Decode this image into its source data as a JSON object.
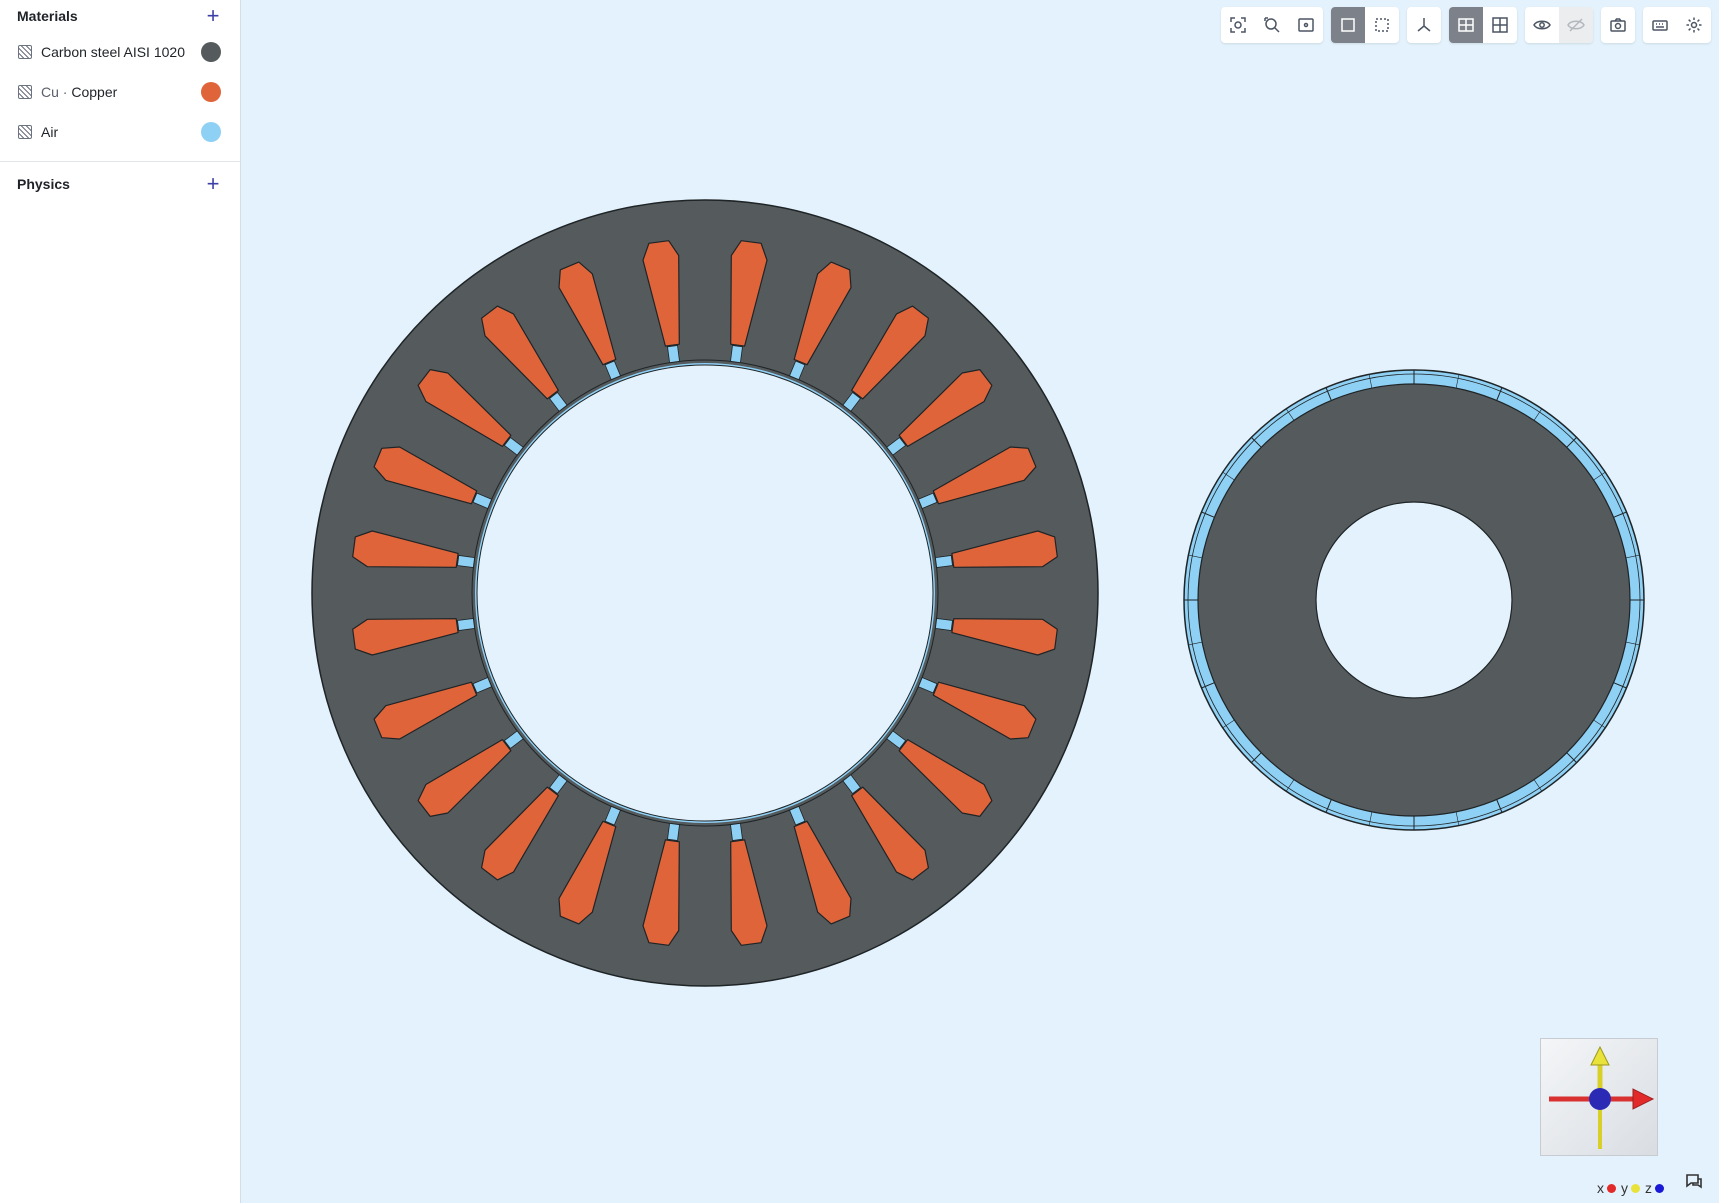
{
  "sidebar": {
    "materials_title": "Materials",
    "physics_title": "Physics",
    "materials": [
      {
        "prefix": "",
        "name": "Carbon steel AISI 1020",
        "color": "#555b5d"
      },
      {
        "prefix": "Cu · ",
        "name": "Copper",
        "color": "#e0643a"
      },
      {
        "prefix": "",
        "name": "Air",
        "color": "#8fd0f5"
      }
    ]
  },
  "toolbar": {
    "icons": [
      "zoom-to-selection-icon",
      "zoom-to-fit-icon",
      "zoom-window-icon",
      "solid-view-icon",
      "wireframe-view-icon",
      "axes-icon",
      "section-view-icon",
      "grid-view-icon",
      "show-icon",
      "hide-icon",
      "screenshot-icon",
      "keyboard-icon",
      "settings-icon"
    ]
  },
  "viewport": {
    "colors": {
      "background": "#e3f2fc",
      "steel": "#555b5d",
      "copper": "#e0643a",
      "air": "#8fd0f5",
      "outline": "#1f2426"
    },
    "stator_slot_count": 24,
    "rotor_magnet_segments": 16
  },
  "triad": {
    "x_label": "x",
    "y_label": "y",
    "z_label": "z",
    "x_color": "#e32a2a",
    "y_color": "#e8e23a",
    "z_color": "#1a1ad6"
  }
}
